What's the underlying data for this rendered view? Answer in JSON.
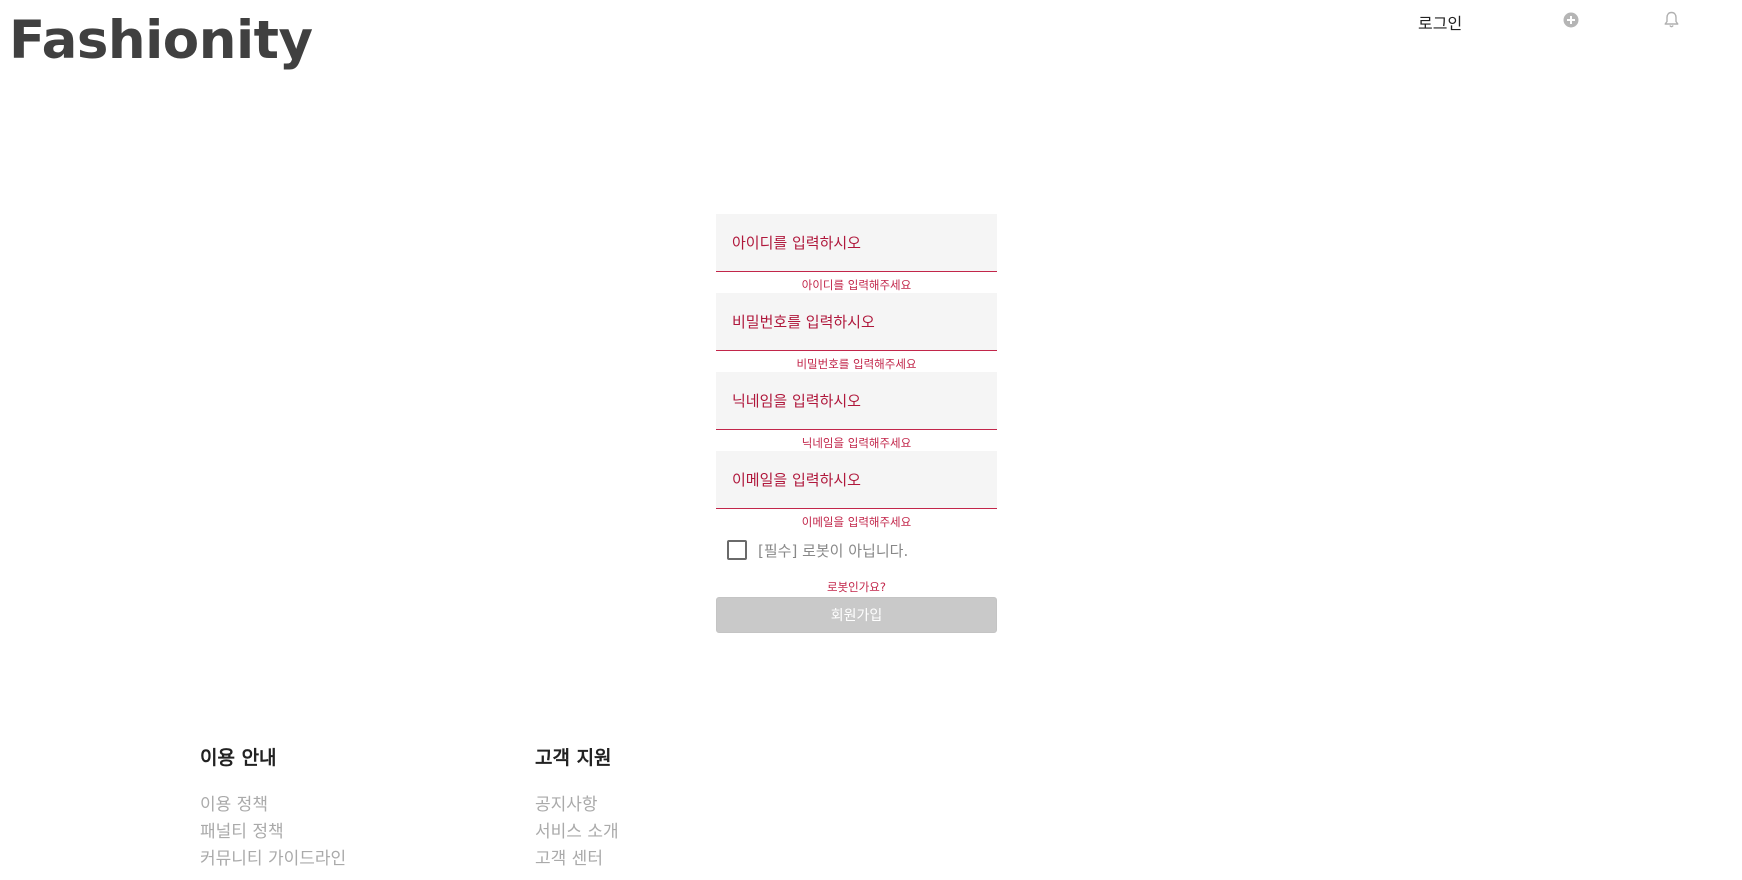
{
  "header": {
    "logo": "Fashionity",
    "login_label": "로그인",
    "add_icon": "plus-circle-icon",
    "bell_icon": "bell-icon"
  },
  "signup_form": {
    "fields": [
      {
        "placeholder": "아이디를 입력하시오",
        "error": "아이디를 입력해주세요"
      },
      {
        "placeholder": "비밀번호를 입력하시오",
        "error": "비밀번호를 입력해주세요"
      },
      {
        "placeholder": "닉네임을 입력하시오",
        "error": "닉네임을 입력해주세요"
      },
      {
        "placeholder": "이메일을 입력하시오",
        "error": "이메일을 입력해주세요"
      }
    ],
    "robot_check_label": "[필수] 로봇이 아닙니다.",
    "robot_check_checked": false,
    "robot_error": "로봇인가요?",
    "submit_label": "회원가입"
  },
  "footer": {
    "usage": {
      "title": "이용 안내",
      "links": [
        "이용 정책",
        "패널티 정책",
        "커뮤니티 가이드라인"
      ]
    },
    "support": {
      "title": "고객 지원",
      "links": [
        "공지사항",
        "서비스 소개",
        "고객 센터"
      ]
    }
  },
  "colors": {
    "accent_error": "#c2264a",
    "field_bg": "#f5f5f5",
    "button_disabled": "#c9c9c9"
  }
}
